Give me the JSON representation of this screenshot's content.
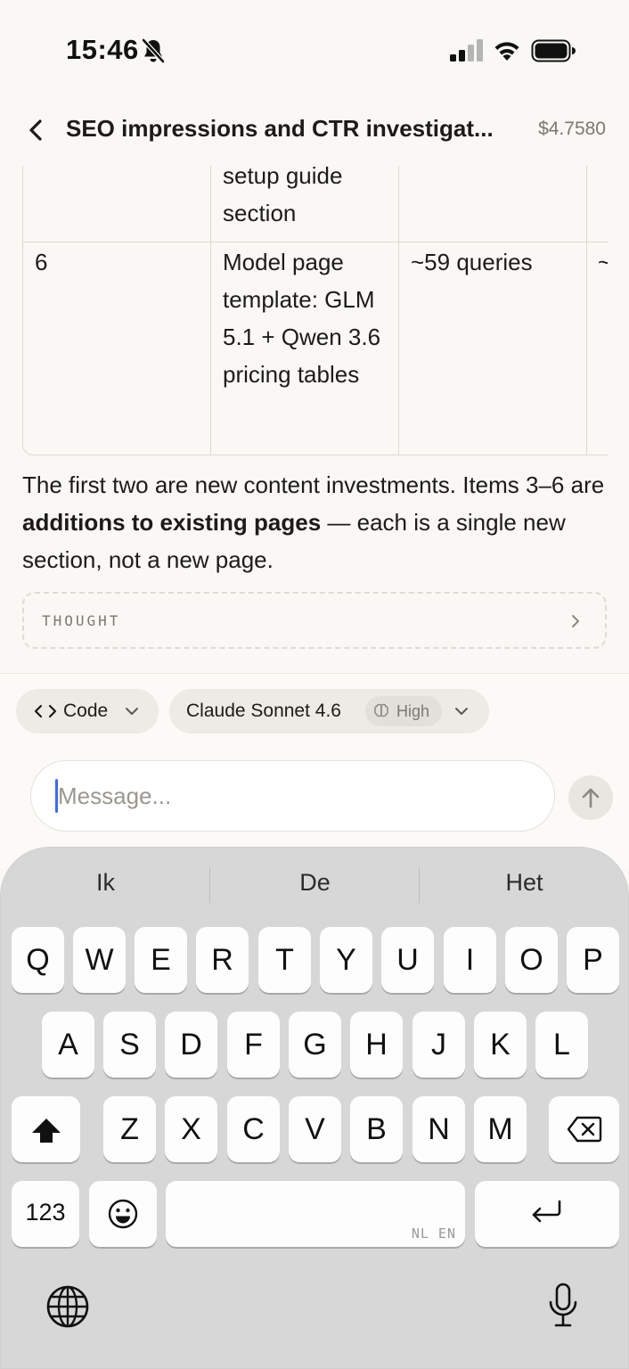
{
  "status_bar": {
    "time": "15:46",
    "icons": [
      "bell-slash-icon",
      "signal-icon",
      "wifi-icon",
      "battery-icon"
    ]
  },
  "header": {
    "title": "SEO impressions and CTR investigat...",
    "cost": "$4.7580"
  },
  "table": {
    "rows": [
      {
        "cells": [
          "",
          "setup guide section",
          "",
          ""
        ]
      },
      {
        "cells": [
          "6",
          "Model page template: GLM 5.1 + Qwen 3.6 pricing tables",
          "~59 queries",
          "~"
        ]
      }
    ]
  },
  "paragraph": {
    "part1": "The first two are new content investments. Items 3–6 are ",
    "bold": "additions to existing pages",
    "part2": " — each is a single new section, not a new page."
  },
  "thought": {
    "label": "THOUGHT"
  },
  "composer": {
    "mode_chip": "Code",
    "model_chip": "Claude Sonnet 4.6",
    "effort": "High",
    "input_placeholder": "Message...",
    "input_value": ""
  },
  "keyboard": {
    "suggestions": [
      "Ik",
      "De",
      "Het"
    ],
    "row1": [
      "Q",
      "W",
      "E",
      "R",
      "T",
      "Y",
      "U",
      "I",
      "O",
      "P"
    ],
    "row2": [
      "A",
      "S",
      "D",
      "F",
      "G",
      "H",
      "J",
      "K",
      "L"
    ],
    "row3": [
      "Z",
      "X",
      "C",
      "V",
      "B",
      "N",
      "M"
    ],
    "numbers_key": "123",
    "space_languages": "NL EN"
  },
  "colors": {
    "background": "#f9f8f4",
    "text": "#1c1b19",
    "muted": "#7a7871",
    "caret": "#3b6cf0",
    "keyboard": "#d7d7d7"
  }
}
